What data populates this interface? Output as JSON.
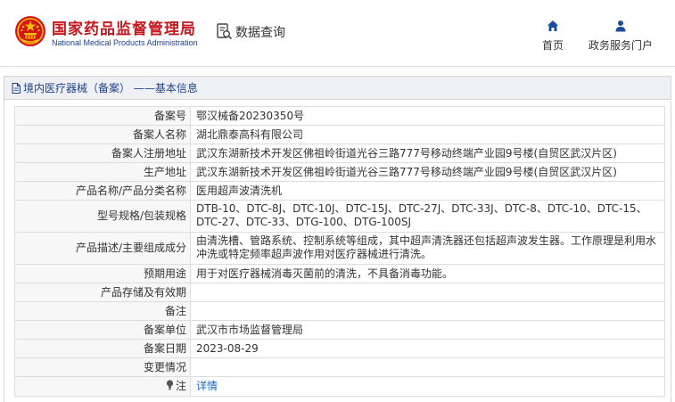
{
  "header": {
    "brand_cn": "国家药品监督管理局",
    "brand_en": "National Medical Products Administration",
    "query_label": "数据查询",
    "nav": [
      {
        "label": "首页",
        "icon": "home-icon"
      },
      {
        "label": "政务服务门户",
        "icon": "user-icon"
      }
    ]
  },
  "panel": {
    "title": "境内医疗器械（备案） ——基本信息"
  },
  "record": {
    "rows": [
      {
        "label": "备案号",
        "value": "鄂汉械备20230350号"
      },
      {
        "label": "备案人名称",
        "value": "湖北鼎泰高科有限公司"
      },
      {
        "label": "备案人注册地址",
        "value": "武汉东湖新技术开发区佛祖岭街道光谷三路777号移动终端产业园9号楼(自贸区武汉片区)"
      },
      {
        "label": "生产地址",
        "value": "武汉东湖新技术开发区佛祖岭街道光谷三路777号移动终端产业园9号楼(自贸区武汉片区)"
      },
      {
        "label": "产品名称/产品分类名称",
        "value": "医用超声波清洗机"
      },
      {
        "label": "型号规格/包装规格",
        "value": "DTB-10、DTC-8J、DTC-10J、DTC-15J、DTC-27J、DTC-33J、DTC-8、DTC-10、DTC-15、DTC-27、DTC-33、DTG-100、DTG-100SJ"
      },
      {
        "label": "产品描述/主要组成成分",
        "value": "由清洗槽、管路系统、控制系统等组成，其中超声清洗器还包括超声波发生器。工作原理是利用水冲洗或特定频率超声波作用对医疗器械进行清洗。"
      },
      {
        "label": "预期用途",
        "value": "用于对医疗器械消毒灭菌前的清洗，不具备消毒功能。"
      },
      {
        "label": "产品存储及有效期",
        "value": ""
      },
      {
        "label": "备注",
        "value": ""
      },
      {
        "label": "备案单位",
        "value": "武汉市市场监督管理局"
      },
      {
        "label": "备案日期",
        "value": "2023-08-29"
      },
      {
        "label": "变更情况",
        "value": ""
      }
    ],
    "note": {
      "label": "注",
      "link": "详情",
      "icon": "bulb-icon"
    }
  },
  "colors": {
    "brand_red": "#c8161d",
    "brand_blue": "#1a3f8f",
    "nav_icon": "#1a4d9c",
    "link": "#1a66c2",
    "label_bg": "#f7f7f7",
    "title_bg": "#eef0f3",
    "border": "#dddddd"
  }
}
